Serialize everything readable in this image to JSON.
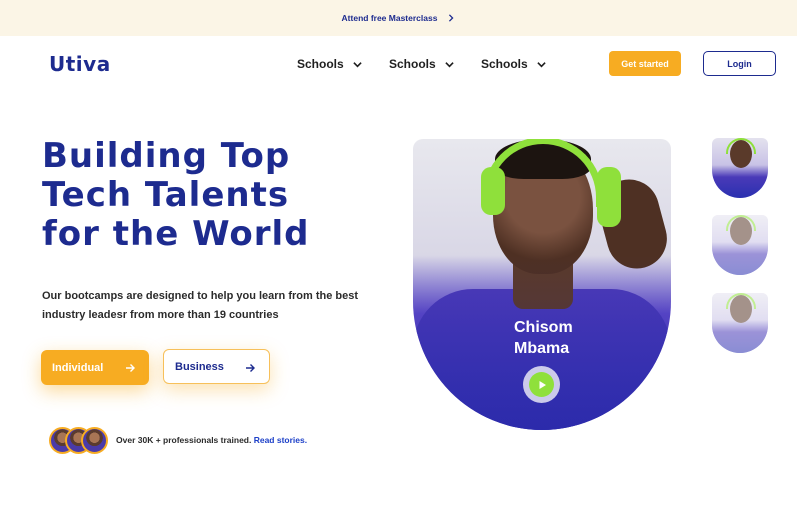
{
  "announcement": {
    "text": "Attend free Masterclass",
    "icon": "chevron-right-icon"
  },
  "logo": {
    "text": "Utiva"
  },
  "nav": {
    "items": [
      {
        "label": "Schools",
        "icon": "chevron-down-icon"
      },
      {
        "label": "Schools",
        "icon": "chevron-down-icon"
      },
      {
        "label": "Schools",
        "icon": "chevron-down-icon"
      }
    ],
    "get_started_label": "Get started",
    "login_label": "Login"
  },
  "hero": {
    "headline_lines": [
      "Building Top",
      "Tech Talents",
      "for the World"
    ],
    "subtext": "Our bootcamps are designed to help you learn from the best industry leadesr  from more than 19 countries",
    "individual_label": "Individual",
    "business_label": "Business",
    "stats_text": "Over 30K + professionals trained. ",
    "stats_link": "Read stories."
  },
  "testimonial": {
    "first_name": "Chisom",
    "last_name": "Mbama",
    "play_icon": "play-icon"
  },
  "colors": {
    "brand_blue": "#1d2b8f",
    "accent_orange": "#f7ac22",
    "banner_bg": "#fbf5e6",
    "headphone_green": "#8fe03b"
  }
}
